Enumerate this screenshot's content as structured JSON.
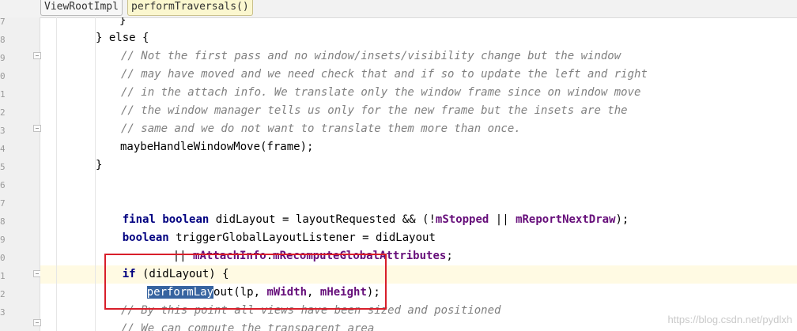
{
  "breadcrumb": {
    "items": [
      "ViewRootImpl",
      "performTraversals()"
    ]
  },
  "gutter": {
    "line_number_fragments": [
      "7",
      "8",
      "9",
      "0",
      "1",
      "2",
      "3",
      "4",
      "5",
      "6",
      "7",
      "8",
      "9",
      "0",
      "1",
      "2",
      "3"
    ]
  },
  "code": {
    "close_brace_top": "}",
    "else_line": "} else {",
    "comments_1": [
      "// Not the first pass and no window/insets/visibility change but the window",
      "// may have moved and we need check that and if so to update the left and right",
      "// in the attach info. We translate only the window frame since on window move",
      "// the window manager tells us only for the new frame but the insets are the",
      "// same and we do not want to translate them more than once."
    ],
    "call_window_move": "maybeHandleWindowMove(frame);",
    "close_else": "}",
    "did_layout_line": {
      "kw1": "final",
      "kw2": "boolean",
      "text1": " didLayout = layoutRequested && (!",
      "field1": "mStopped",
      "text2": " || ",
      "field2": "mReportNextDraw",
      "text3": ");"
    },
    "trigger_line": {
      "kw": "boolean",
      "text": " triggerGlobalLayoutListener = didLayout"
    },
    "recompute_line": {
      "text1": "|| ",
      "field1": "mAttachInfo",
      "dot": ".",
      "field2": "mRecomputeGlobalAttributes",
      "text2": ";"
    },
    "if_line": {
      "kw": "if",
      "text": " (didLayout) {"
    },
    "perform_layout_line": {
      "selected": "performLay",
      "rest": "out(lp, ",
      "field1": "mWidth",
      "comma": ", ",
      "field2": "mHeight",
      "end": ");"
    },
    "comments_2": [
      "// By this point all views have been sized and positioned",
      "// We can compute the transparent area"
    ]
  },
  "watermark": "https://blog.csdn.net/pydlxh",
  "colors": {
    "keyword": "#000080",
    "comment": "#808080",
    "field": "#660e7a",
    "selection": "#3764a0",
    "annotation_box": "#d81e2a",
    "caret_row": "#fffae3"
  }
}
